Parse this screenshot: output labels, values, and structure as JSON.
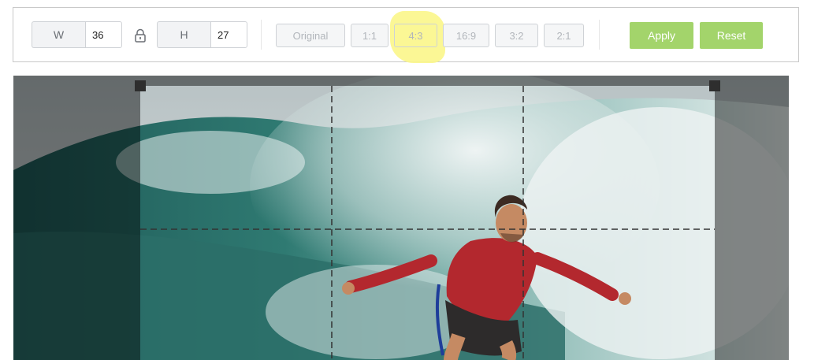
{
  "toolbar": {
    "width": {
      "label": "W",
      "value": "36"
    },
    "height": {
      "label": "H",
      "value": "27"
    },
    "ratios": [
      {
        "label": "Original"
      },
      {
        "label": "1:1"
      },
      {
        "label": "4:3"
      },
      {
        "label": "16:9"
      },
      {
        "label": "3:2"
      },
      {
        "label": "2:1"
      }
    ],
    "apply_label": "Apply",
    "reset_label": "Reset"
  },
  "colors": {
    "accent_green": "#a3d46b",
    "highlight_yellow": "#fbf68a",
    "overlay": "#000000"
  },
  "icons": {
    "lock": "lock-icon"
  }
}
